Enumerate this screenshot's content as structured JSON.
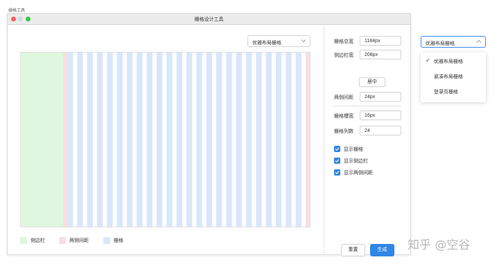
{
  "page_label": "栅格工具",
  "window": {
    "title": "栅格设计工具"
  },
  "layout_select": {
    "selected": "优雅布局栅格",
    "icon": "chevron-down-icon"
  },
  "preview": {
    "sidebar_color": "#dff6df",
    "gutter_color": "#f7dfe3",
    "column_color": "#d9e7fb",
    "column_count": 24
  },
  "legend": [
    {
      "label": "侧边栏",
      "color": "#dff6df"
    },
    {
      "label": "两侧间距",
      "color": "#f7dfe3"
    },
    {
      "label": "栅格",
      "color": "#d9e7fb"
    }
  ],
  "form": {
    "total_width": {
      "label": "栅格总宽",
      "value": "1184px"
    },
    "sidebar_width": {
      "label": "侧边栏宽",
      "value": "208px"
    },
    "center_label": "居中",
    "side_spacing": {
      "label": "两侧间距",
      "value": "24px"
    },
    "gutter_width": {
      "label": "栅格槽宽",
      "value": "16px"
    },
    "column_count": {
      "label": "栅格列数",
      "value": "24"
    }
  },
  "checkboxes": [
    {
      "label": "显示栅格",
      "checked": true
    },
    {
      "label": "显示侧边栏",
      "checked": true
    },
    {
      "label": "显示两侧间距",
      "checked": true
    }
  ],
  "buttons": {
    "reset": "重置",
    "generate": "生成"
  },
  "floating_select": {
    "selected": "优雅布局栅格",
    "icon": "chevron-up-icon",
    "options": [
      {
        "label": "优雅布局栅格",
        "selected": true
      },
      {
        "label": "紧凑布局栅格",
        "selected": false
      },
      {
        "label": "登录页栅格",
        "selected": false
      }
    ]
  },
  "watermark": "知乎 @空谷",
  "colors": {
    "accent": "#2f86e6",
    "close": "#fc605c",
    "maximize": "#34c84a"
  }
}
